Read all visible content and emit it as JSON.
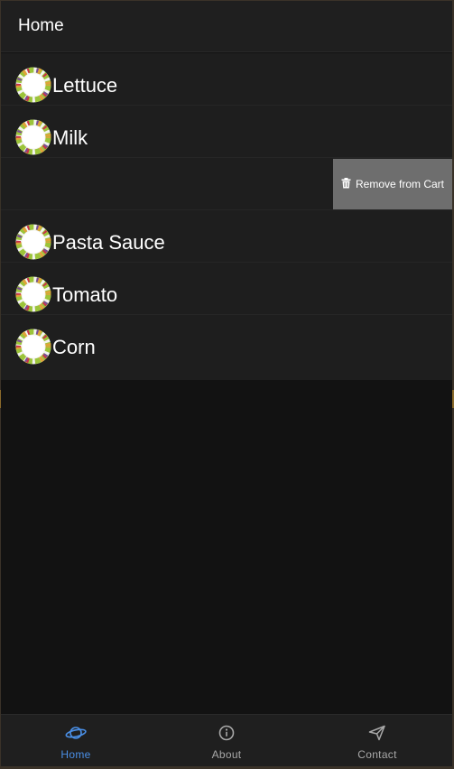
{
  "header": {
    "title": "Home"
  },
  "list": {
    "items": [
      {
        "label": "Lettuce",
        "icon": "vegetable-wreath-icon"
      },
      {
        "label": "Milk",
        "icon": "vegetable-wreath-icon"
      },
      {
        "label": "",
        "icon": ""
      },
      {
        "label": "Pasta Sauce",
        "icon": "vegetable-wreath-icon"
      },
      {
        "label": "Tomato",
        "icon": "vegetable-wreath-icon"
      },
      {
        "label": "Corn",
        "icon": "vegetable-wreath-icon"
      }
    ],
    "swipe_action": {
      "label": "Remove from Cart",
      "icon": "trash-icon"
    }
  },
  "tabs": [
    {
      "label": "Home",
      "icon": "planet-icon",
      "active": true
    },
    {
      "label": "About",
      "icon": "info-circle-icon",
      "active": false
    },
    {
      "label": "Contact",
      "icon": "send-icon",
      "active": false
    }
  ],
  "colors": {
    "accent": "#4a8fe6",
    "background": "#121212",
    "surface": "#1e1e1e",
    "swipe_action_bg": "#6e6e6e"
  }
}
